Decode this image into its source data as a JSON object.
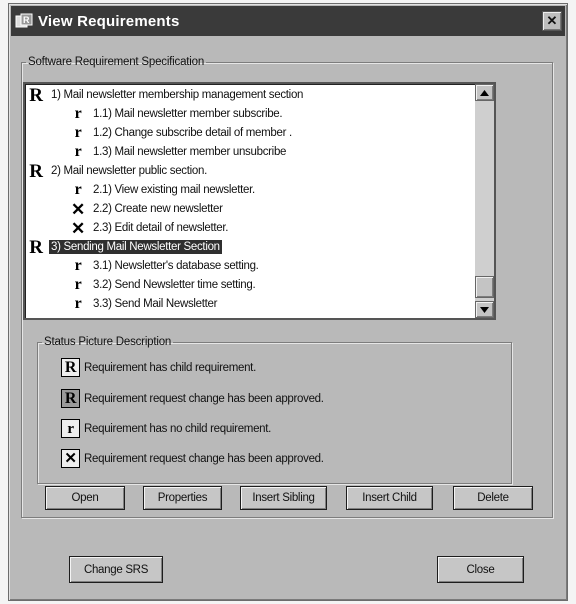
{
  "window": {
    "title": "View Requirements",
    "close_glyph": "✕"
  },
  "srs_group": {
    "legend": "Software Requirement Specification"
  },
  "tree": {
    "items": [
      {
        "icon": "R",
        "label": "1) Mail newsletter membership management section",
        "selected": false
      },
      {
        "icon": "r",
        "label": "1.1) Mail newsletter member subscribe.",
        "selected": false
      },
      {
        "icon": "r",
        "label": "1.2) Change subscribe detail of member .",
        "selected": false
      },
      {
        "icon": "r",
        "label": "1.3) Mail newsletter member unsubcribe",
        "selected": false
      },
      {
        "icon": "R",
        "label": "2) Mail newsletter public section.",
        "selected": false
      },
      {
        "icon": "r",
        "label": "2.1) View existing mail newsletter.",
        "selected": false
      },
      {
        "icon": "X",
        "label": "2.2) Create new newsletter",
        "selected": false
      },
      {
        "icon": "X",
        "label": "2.3) Edit detail of newsletter.",
        "selected": false
      },
      {
        "icon": "R",
        "label": "3) Sending Mail Newsletter Section",
        "selected": true
      },
      {
        "icon": "r",
        "label": "3.1) Newsletter's database setting.",
        "selected": false
      },
      {
        "icon": "r",
        "label": "3.2) Send Newsletter time setting.",
        "selected": false
      },
      {
        "icon": "r",
        "label": "3.3) Send Mail Newsletter",
        "selected": false
      }
    ]
  },
  "status_group": {
    "legend": "Status Picture Description",
    "items": [
      {
        "icon": "R",
        "approved": false,
        "text": "Requirement has child requirement."
      },
      {
        "icon": "R",
        "approved": true,
        "text": "Requirement request change has been approved."
      },
      {
        "icon": "r",
        "approved": false,
        "text": "Requirement has no child requirement."
      },
      {
        "icon": "X",
        "approved": false,
        "text": "Requirement request change has been approved."
      }
    ]
  },
  "buttons": {
    "open": "Open",
    "properties": "Properties",
    "insert_sibling": "Insert Sibling",
    "insert_child": "Insert Child",
    "delete": "Delete",
    "change_srs": "Change SRS",
    "close": "Close"
  },
  "colors": {
    "titlebar": "#3a3a3a",
    "dialog_bg": "#b9b9b9",
    "selection": "#2f2f2f"
  }
}
